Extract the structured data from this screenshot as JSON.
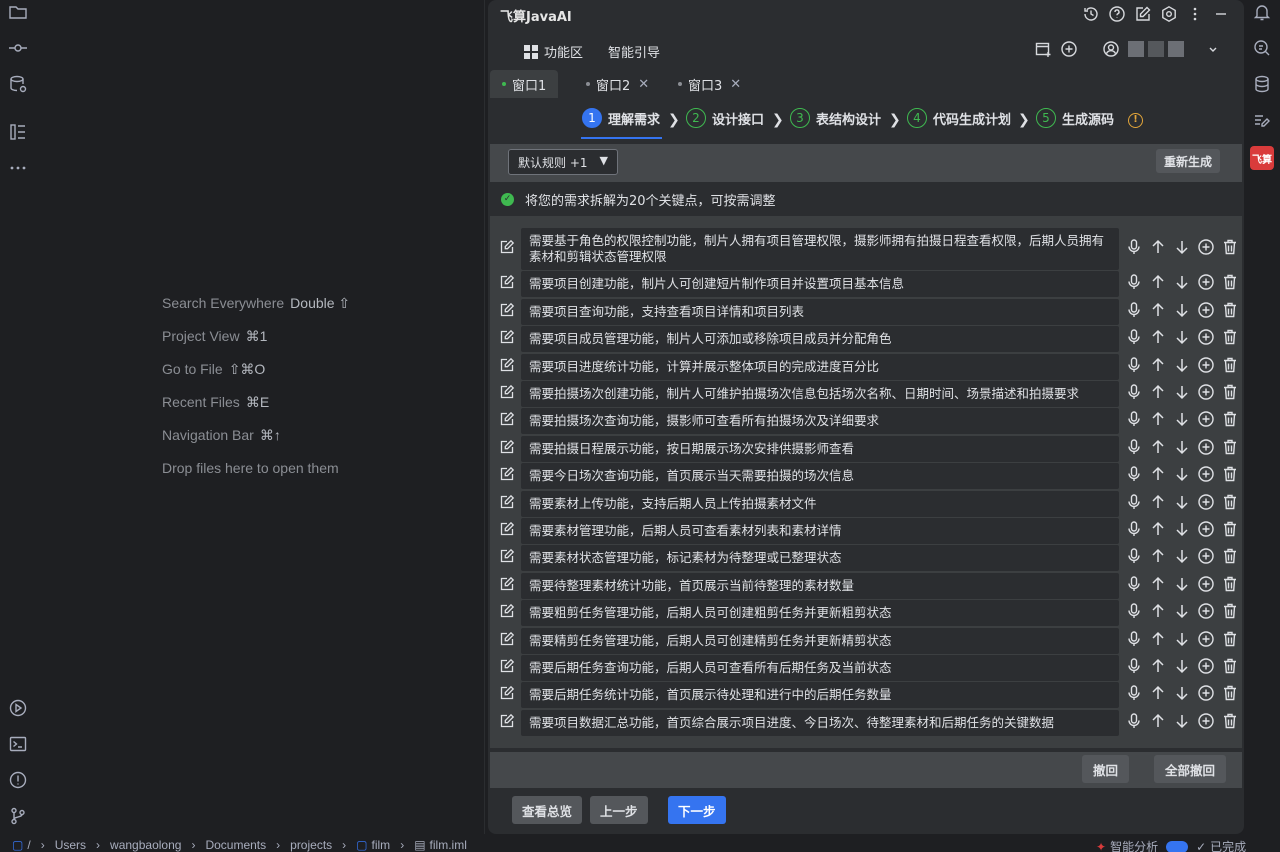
{
  "editor_hints": [
    {
      "label": "Search Everywhere",
      "key": "Double ⇧"
    },
    {
      "label": "Project View",
      "key": "⌘1"
    },
    {
      "label": "Go to File",
      "key": "⇧⌘O"
    },
    {
      "label": "Recent Files",
      "key": "⌘E"
    },
    {
      "label": "Navigation Bar",
      "key": "⌘↑"
    },
    {
      "label": "Drop files here to open them",
      "key": ""
    }
  ],
  "plugin": {
    "title": "飞算JavaAI",
    "nav": {
      "workspace": "功能区",
      "guide": "智能引导"
    },
    "tabs": [
      {
        "label": "窗口1",
        "active": true,
        "closable": false
      },
      {
        "label": "窗口2",
        "active": false,
        "closable": true
      },
      {
        "label": "窗口3",
        "active": false,
        "closable": true
      }
    ],
    "steps": [
      {
        "num": "1",
        "label": "理解需求"
      },
      {
        "num": "2",
        "label": "设计接口"
      },
      {
        "num": "3",
        "label": "表结构设计"
      },
      {
        "num": "4",
        "label": "代码生成计划"
      },
      {
        "num": "5",
        "label": "生成源码"
      }
    ],
    "rule_select": "默认规则 +1",
    "regenerate": "重新生成",
    "notice": "将您的需求拆解为20个关键点，可按需调整",
    "requirements": [
      "需要基于角色的权限控制功能，制片人拥有项目管理权限，摄影师拥有拍摄日程查看权限，后期人员拥有素材和剪辑状态管理权限",
      "需要项目创建功能，制片人可创建短片制作项目并设置项目基本信息",
      "需要项目查询功能，支持查看项目详情和项目列表",
      "需要项目成员管理功能，制片人可添加或移除项目成员并分配角色",
      "需要项目进度统计功能，计算并展示整体项目的完成进度百分比",
      "需要拍摄场次创建功能，制片人可维护拍摄场次信息包括场次名称、日期时间、场景描述和拍摄要求",
      "需要拍摄场次查询功能，摄影师可查看所有拍摄场次及详细要求",
      "需要拍摄日程展示功能，按日期展示场次安排供摄影师查看",
      "需要今日场次查询功能，首页展示当天需要拍摄的场次信息",
      "需要素材上传功能，支持后期人员上传拍摄素材文件",
      "需要素材管理功能，后期人员可查看素材列表和素材详情",
      "需要素材状态管理功能，标记素材为待整理或已整理状态",
      "需要待整理素材统计功能，首页展示当前待整理的素材数量",
      "需要粗剪任务管理功能，后期人员可创建粗剪任务并更新粗剪状态",
      "需要精剪任务管理功能，后期人员可创建精剪任务并更新精剪状态",
      "需要后期任务查询功能，后期人员可查看所有后期任务及当前状态",
      "需要后期任务统计功能，首页展示待处理和进行中的后期任务数量",
      "需要项目数据汇总功能，首页综合展示项目进度、今日场次、待整理素材和后期任务的关键数据"
    ],
    "undo": "撤回",
    "undo_all": "全部撤回",
    "overview": "查看总览",
    "prev": "上一步",
    "next": "下一步"
  },
  "status_bar": {
    "path": [
      "Users",
      "wangbaolong",
      "Documents",
      "projects",
      "film",
      "film.iml"
    ],
    "right_text": "智能分析",
    "right_status": "已完成"
  },
  "colors": {
    "accent": "#3574f0",
    "success": "#3fb950",
    "warning": "#e2a53a",
    "brand": "#d93b3b"
  }
}
